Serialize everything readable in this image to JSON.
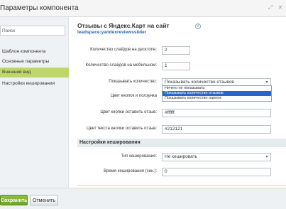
{
  "window": {
    "title": "Параметры компонента"
  },
  "sidebar": {
    "search_placeholder": "Поиск",
    "items": [
      {
        "label": "Шаблон компонента"
      },
      {
        "label": "Основные параметры"
      },
      {
        "label": "Внешний вид"
      },
      {
        "label": "Настройки кеширования"
      }
    ],
    "active_color": "#bfd76a"
  },
  "component": {
    "name": "Отзывы с Яндекс.Карт на сайт",
    "code": "leadspace:yandexreviewsslider"
  },
  "params": {
    "slides_desktop": {
      "label": "Количество слайдов на десктопе:",
      "value": "2"
    },
    "slides_mobile": {
      "label": "Количество слайдов на мобильном:",
      "value": "1"
    },
    "show_count": {
      "label": "Показывать количество:",
      "value": "Показывать количество отзывов",
      "options": [
        "Ничего не показывать",
        "Показывать количество отзывов",
        "Показывать количество оценок"
      ]
    },
    "btn_color": {
      "label": "Цвет кнопок и ползунка"
    },
    "leave_btn_color": {
      "label": "Цвет кнопки оставить отзыв:",
      "value": "#ffffff"
    },
    "leave_btn_text_color": {
      "label": "Цвет текста кнопки оставить отзыв:",
      "value": "#212121"
    }
  },
  "caching": {
    "section_title": "Настройки кеширования",
    "type": {
      "label": "Тип кеширования:",
      "value": "Не кешировать"
    },
    "time": {
      "label": "Время кеширования (сек.):",
      "value": "0"
    }
  },
  "footer": {
    "save_label": "Сохранить",
    "cancel_label": "Отменить"
  },
  "colors": {
    "accent_green": "#6ea22a",
    "selected_option": "#2a66c8",
    "link_blue": "#2067b0"
  }
}
